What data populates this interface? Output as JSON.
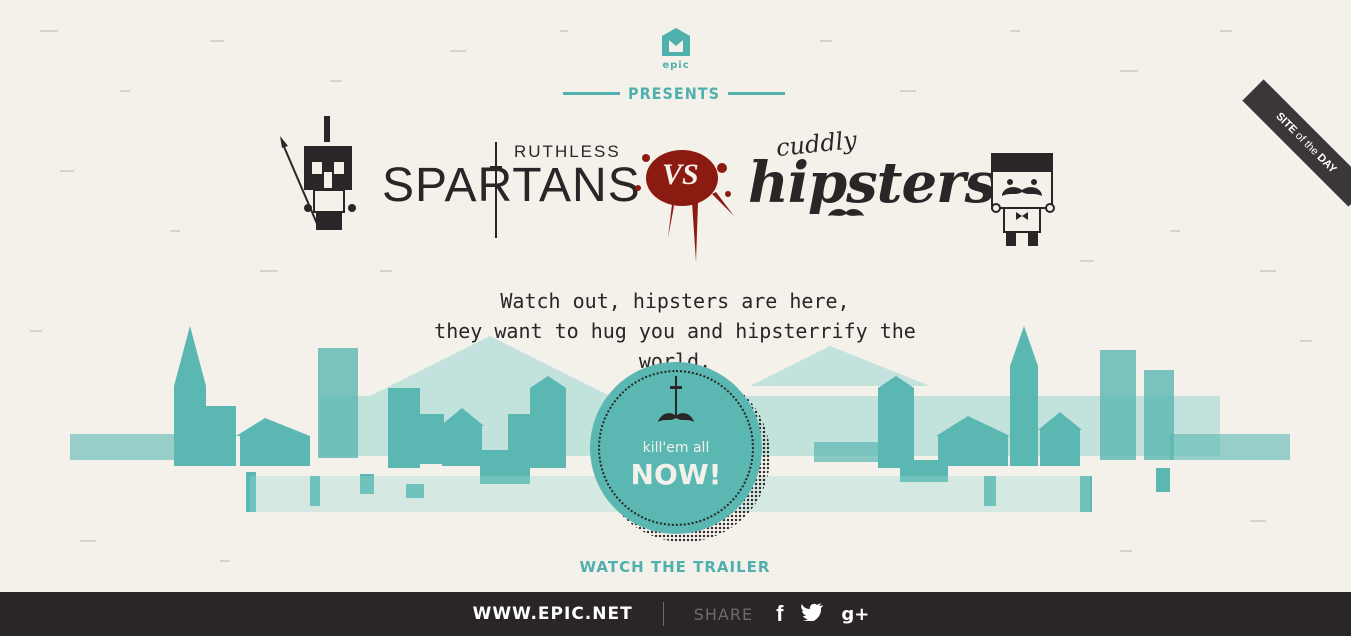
{
  "logo": {
    "text": "epic"
  },
  "header": {
    "presents": "PRESENTS"
  },
  "versus": {
    "left_adjective": "RUTHLESS",
    "left_name": "SPARTANS",
    "vs": "VS",
    "right_adjective": "cuddly",
    "right_name": "hipsters"
  },
  "tagline": {
    "line1": "Watch out, hipsters are here,",
    "line2": "they want to hug you and hipsterrify the world."
  },
  "cta": {
    "line1": "kill'em all",
    "line2": "NOW!"
  },
  "trailer_link": "WATCH THE TRAILER",
  "ribbon": {
    "site": "SITE",
    "of": "of",
    "the": "the",
    "day": "DAY"
  },
  "footer": {
    "url": "WWW.EPIC.NET",
    "share_label": "SHARE",
    "social": [
      {
        "name": "facebook-icon",
        "glyph": "f"
      },
      {
        "name": "twitter-icon",
        "glyph": "🐦"
      },
      {
        "name": "google-plus-icon",
        "glyph": "g+"
      }
    ]
  },
  "colors": {
    "background": "#f4f1ea",
    "teal": "#5ab7b2",
    "dark": "#2a2526",
    "blood": "#8b1a10"
  }
}
